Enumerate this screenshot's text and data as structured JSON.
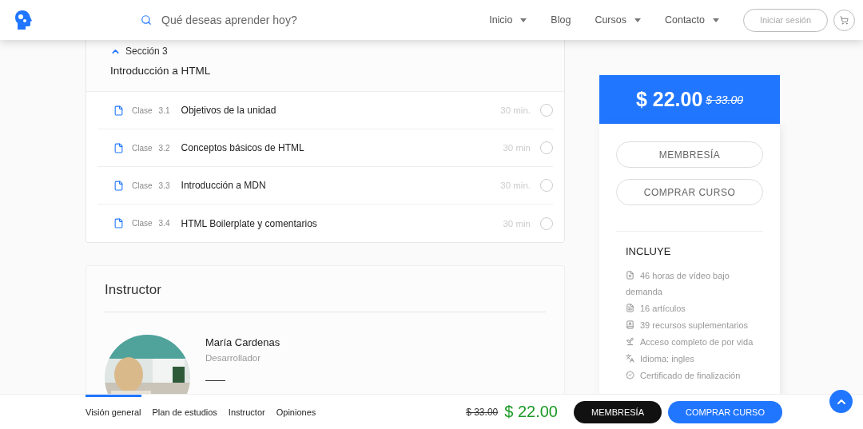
{
  "header": {
    "search": {
      "placeholder": "Qué deseas aprender hoy?"
    },
    "nav": [
      {
        "label": "Inicio",
        "dropdown": true
      },
      {
        "label": "Blog",
        "dropdown": false
      },
      {
        "label": "Cursos",
        "dropdown": true
      },
      {
        "label": "Contacto",
        "dropdown": true
      }
    ],
    "login": "Iniciar sesión"
  },
  "section": {
    "title": "Sección 3",
    "subtitle": "Introducción a HTML",
    "expanded": true,
    "lessons": [
      {
        "prefix": "Clase",
        "number": "3.1",
        "title": "Objetivos de la unidad",
        "duration": "30 min.",
        "completed": false
      },
      {
        "prefix": "Clase",
        "number": "3.2",
        "title": "Conceptos básicos de HTML",
        "duration": "30 min",
        "completed": false
      },
      {
        "prefix": "Clase",
        "number": "3.3",
        "title": "Introducción a MDN",
        "duration": "30 min.",
        "completed": false
      },
      {
        "prefix": "Clase",
        "number": "3.4",
        "title": "HTML Boilerplate y comentarios",
        "duration": "30 min",
        "completed": false
      }
    ]
  },
  "instructor": {
    "heading": "Instructor",
    "name": "María Cardenas",
    "role": "Desarrollador"
  },
  "sidebar": {
    "price": "$ 22.00",
    "old_price": "$ 33.00",
    "buttons": [
      "MEMBRESÍA",
      "COMPRAR CURSO"
    ],
    "includes_title": "INCLUYE",
    "includes": [
      {
        "kind": "video",
        "text": "46 horas de vídeo bajo demanda"
      },
      {
        "kind": "article",
        "text": "16 artículos"
      },
      {
        "kind": "resource",
        "text": "39 recursos suplementarios"
      },
      {
        "kind": "access",
        "text": "Acceso completo de por vida"
      },
      {
        "kind": "language",
        "text": "Idioma: ingles"
      },
      {
        "kind": "certificate",
        "text": "Certificado de finalización"
      }
    ]
  },
  "bottom_bar": {
    "tabs": [
      {
        "label": "Visión general",
        "selected": true
      },
      {
        "label": "Plan de estudios",
        "selected": false
      },
      {
        "label": "Instructor",
        "selected": false
      },
      {
        "label": "Opiniones",
        "selected": false
      }
    ],
    "old_price": "$ 33.00",
    "price": "$ 22.00",
    "membership": "MEMBRESÍA",
    "buy": "COMPRAR CURSO"
  }
}
